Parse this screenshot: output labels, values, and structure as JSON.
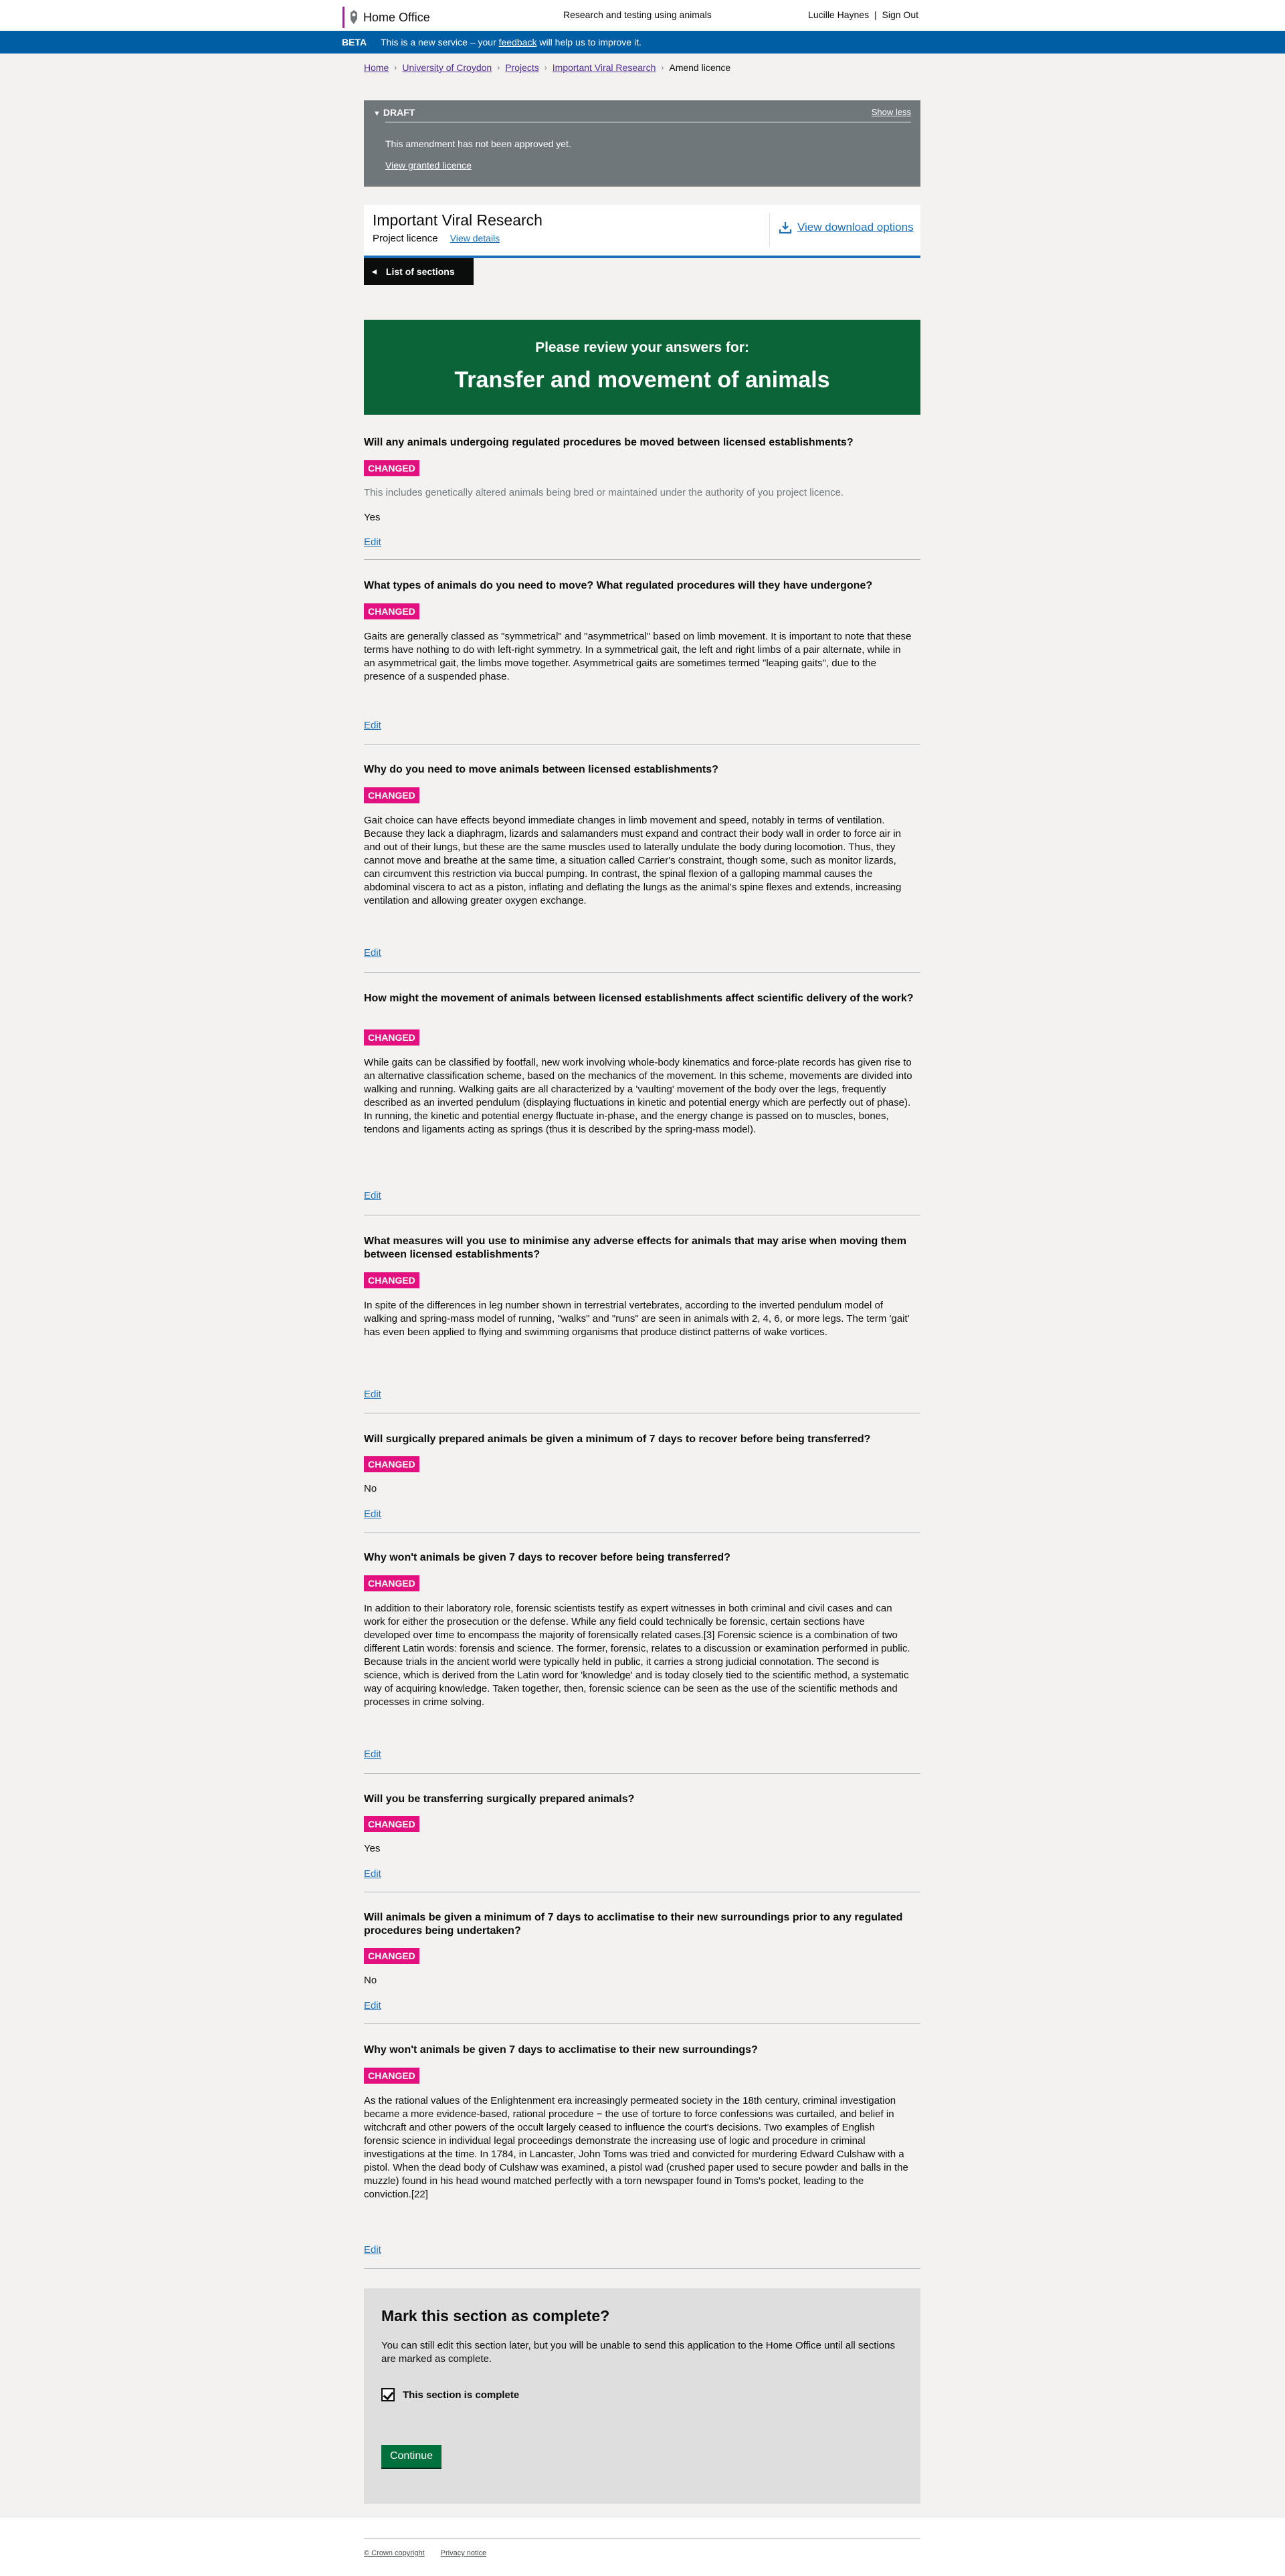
{
  "header": {
    "logo_text": "Home Office",
    "service_name": "Research and testing using animals",
    "user_name": "Lucille Haynes",
    "separator": "|",
    "sign_out": "Sign Out"
  },
  "beta": {
    "tag": "BETA",
    "text_before": "This is a new service – your ",
    "link": "feedback",
    "text_after": " will help us to improve it."
  },
  "breadcrumbs": [
    "Home",
    "University of Croydon",
    "Projects",
    "Important Viral Research",
    "Amend licence"
  ],
  "draft": {
    "title": "DRAFT",
    "show_less": "Show less",
    "message": "This amendment has not been approved yet.",
    "view_granted": "View granted licence"
  },
  "licence": {
    "title": "Important Viral Research",
    "type": "Project licence",
    "view_details": "View details",
    "download": "View download options"
  },
  "list_sections": "List of sections",
  "banner": {
    "review": "Please review your answers for:",
    "section": "Transfer and movement of animals"
  },
  "questions": [
    {
      "title": "Will any animals undergoing regulated procedures be moved between licensed establishments?",
      "badge": "CHANGED",
      "hint": "This includes genetically altered animals being bred or maintained under the authority of you project licence.",
      "answer": "Yes",
      "edit": "Edit"
    },
    {
      "title": "What types of animals do you need to move? What regulated procedures will they have undergone?",
      "badge": "CHANGED",
      "answer": "Gaits are generally classed as \"symmetrical\" and \"asymmetrical\" based on limb movement. It is important to note that these terms have nothing to do with left-right symmetry. In a symmetrical gait, the left and right limbs of a pair alternate, while in an asymmetrical gait, the limbs move together. Asymmetrical gaits are sometimes termed \"leaping gaits\", due to the presence of a suspended phase.",
      "edit": "Edit"
    },
    {
      "title": "Why do you need to move animals between licensed establishments?",
      "badge": "CHANGED",
      "answer": "Gait choice can have effects beyond immediate changes in limb movement and speed, notably in terms of ventilation. Because they lack a diaphragm, lizards and salamanders must expand and contract their body wall in order to force air in and out of their lungs, but these are the same muscles used to laterally undulate the body during locomotion. Thus, they cannot move and breathe at the same time, a situation called Carrier's constraint, though some, such as monitor lizards, can circumvent this restriction via buccal pumping. In contrast, the spinal flexion of a galloping mammal causes the abdominal viscera to act as a piston, inflating and deflating the lungs as the animal's spine flexes and extends, increasing ventilation and allowing greater oxygen exchange.",
      "edit": "Edit"
    },
    {
      "title": "How might the movement of animals between licensed establishments affect scientific delivery of the work?",
      "badge": "CHANGED",
      "answer": "While gaits can be classified by footfall, new work involving whole-body kinematics and force-plate records has given rise to an alternative classification scheme, based on the mechanics of the movement. In this scheme, movements are divided into walking and running. Walking gaits are all characterized by a 'vaulting' movement of the body over the legs, frequently described as an inverted pendulum (displaying fluctuations in kinetic and potential energy which are perfectly out of phase). In running, the kinetic and potential energy fluctuate in-phase, and the energy change is passed on to muscles, bones, tendons and ligaments acting as springs (thus it is described by the spring-mass model).",
      "edit": "Edit"
    },
    {
      "title": "What measures will you use to minimise any adverse effects for animals that may arise when moving them between licensed establishments?",
      "badge": "CHANGED",
      "answer": "In spite of the differences in leg number shown in terrestrial vertebrates, according to the inverted pendulum model of walking and spring-mass model of running, \"walks\" and \"runs\" are seen in animals with 2, 4, 6, or more legs. The term 'gait' has even been applied to flying and swimming organisms that produce distinct patterns of wake vortices.",
      "edit": "Edit"
    },
    {
      "title": "Will surgically prepared animals be given a minimum of 7 days to recover before being transferred?",
      "badge": "CHANGED",
      "answer": "No",
      "edit": "Edit"
    },
    {
      "title": "Why won't animals be given 7 days to recover before being transferred?",
      "badge": "CHANGED",
      "answer": "In addition to their laboratory role, forensic scientists testify as expert witnesses in both criminal and civil cases and can work for either the prosecution or the defense. While any field could technically be forensic, certain sections have developed over time to encompass the majority of forensically related cases.[3] Forensic science is a combination of two different Latin words: forensis and science. The former, forensic, relates to a discussion or examination performed in public. Because trials in the ancient world were typically held in public, it carries a strong judicial connotation. The second is science, which is derived from the Latin word for 'knowledge' and is today closely tied to the scientific method, a systematic way of acquiring knowledge. Taken together, then, forensic science can be seen as the use of the scientific methods and processes in crime solving.",
      "edit": "Edit"
    },
    {
      "title": "Will you be transferring surgically prepared animals?",
      "badge": "CHANGED",
      "answer": "Yes",
      "edit": "Edit"
    },
    {
      "title": "Will animals be given a minimum of 7 days to acclimatise to their new surroundings prior to any regulated procedures being undertaken?",
      "badge": "CHANGED",
      "answer": "No",
      "edit": "Edit"
    },
    {
      "title": "Why won't  animals be given 7 days to acclimatise to their new surroundings?",
      "badge": "CHANGED",
      "answer": "As the rational values of the Enlightenment era increasingly permeated society in the 18th century, criminal investigation became a more evidence-based, rational procedure − the use of torture to force confessions was curtailed, and belief in witchcraft and other powers of the occult largely ceased to influence the court's decisions. Two examples of English forensic science in individual legal proceedings demonstrate the increasing use of logic and procedure in criminal investigations at the time. In 1784, in Lancaster, John Toms was tried and convicted for murdering Edward Culshaw with a pistol. When the dead body of Culshaw was examined, a pistol wad (crushed paper used to secure powder and balls in the muzzle) found in his head wound matched perfectly with a torn newspaper found in Toms's pocket, leading to the conviction.[22]",
      "edit": "Edit"
    }
  ],
  "complete": {
    "heading": "Mark this section as complete?",
    "text": "You can still edit this section later, but you will be unable to send this application to the Home Office until all sections are marked as complete.",
    "checkbox_label": "This section is complete",
    "checked": true,
    "continue": "Continue"
  },
  "footer": {
    "copyright": "© Crown copyright",
    "privacy": "Privacy notice"
  }
}
